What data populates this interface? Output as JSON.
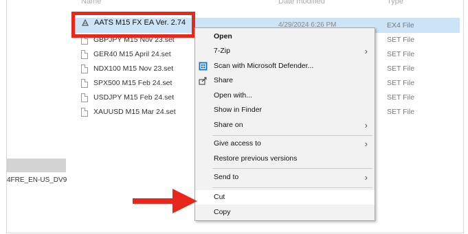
{
  "columns": {
    "name": "Name",
    "date": "Date modified",
    "type": "Type"
  },
  "files": [
    {
      "name": "AATS M15 FX EA Ver. 2.74",
      "date": "4/29/2024 6:26 PM",
      "type": "EX4 File",
      "icon": "app-icon"
    },
    {
      "name": "GBPJPY M15 Nov 23.set",
      "date": "",
      "type": "SET File",
      "icon": "file-icon"
    },
    {
      "name": "GER40 M15 April 24.set",
      "date": "",
      "type": "SET File",
      "icon": "file-icon"
    },
    {
      "name": "NDX100 M15 Nov 23.set",
      "date": "",
      "type": "SET File",
      "icon": "file-icon"
    },
    {
      "name": "SPX500 M15 Feb 24.set",
      "date": "",
      "type": "SET File",
      "icon": "file-icon"
    },
    {
      "name": "USDJPY M15 Feb 24.set",
      "date": "",
      "type": "SET File",
      "icon": "file-icon"
    },
    {
      "name": "XAUUSD M15  Mar 24.set",
      "date": "",
      "type": "SET File",
      "icon": "file-icon"
    }
  ],
  "sidebar": {
    "selected_item": "",
    "item_text": "4FRE_EN-US_DV9"
  },
  "context_menu": {
    "open": "Open",
    "zip": "7-Zip",
    "scan": "Scan with Microsoft Defender...",
    "share": "Share",
    "open_with": "Open with...",
    "show_in_finder": "Show in Finder",
    "share_on": "Share on",
    "give_access": "Give access to",
    "restore": "Restore previous versions",
    "send_to": "Send to",
    "cut": "Cut",
    "copy": "Copy"
  },
  "colors": {
    "highlight": "#e8281d",
    "selection": "#cce4f7",
    "menu_bg": "#f2f2f2",
    "defender": "#1a73c9"
  }
}
